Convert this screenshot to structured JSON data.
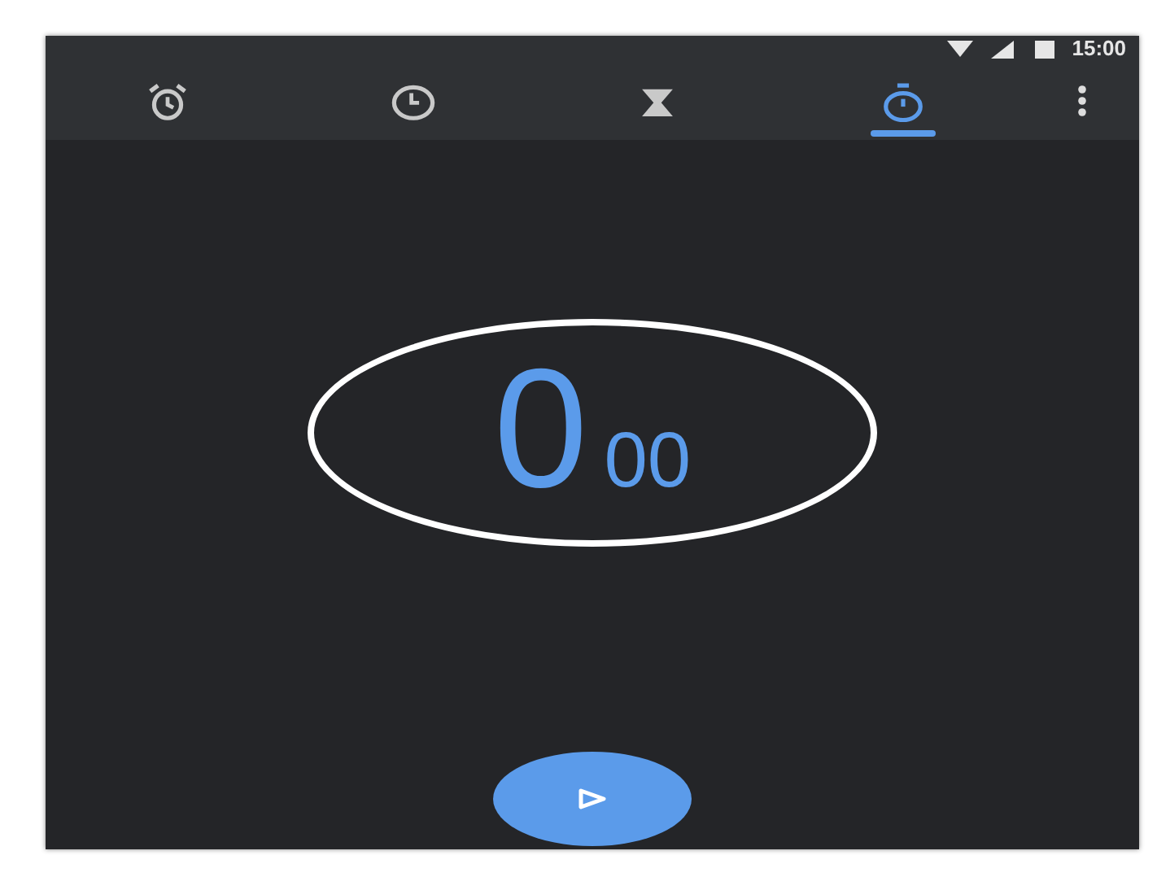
{
  "status_bar": {
    "time": "15:00"
  },
  "tabs": [
    {
      "kind": "alarm",
      "selected": false
    },
    {
      "kind": "clock",
      "selected": false
    },
    {
      "kind": "timer",
      "selected": false
    },
    {
      "kind": "stopwatch",
      "selected": true
    }
  ],
  "stopwatch": {
    "seconds": "0",
    "hundredths": "00"
  }
}
